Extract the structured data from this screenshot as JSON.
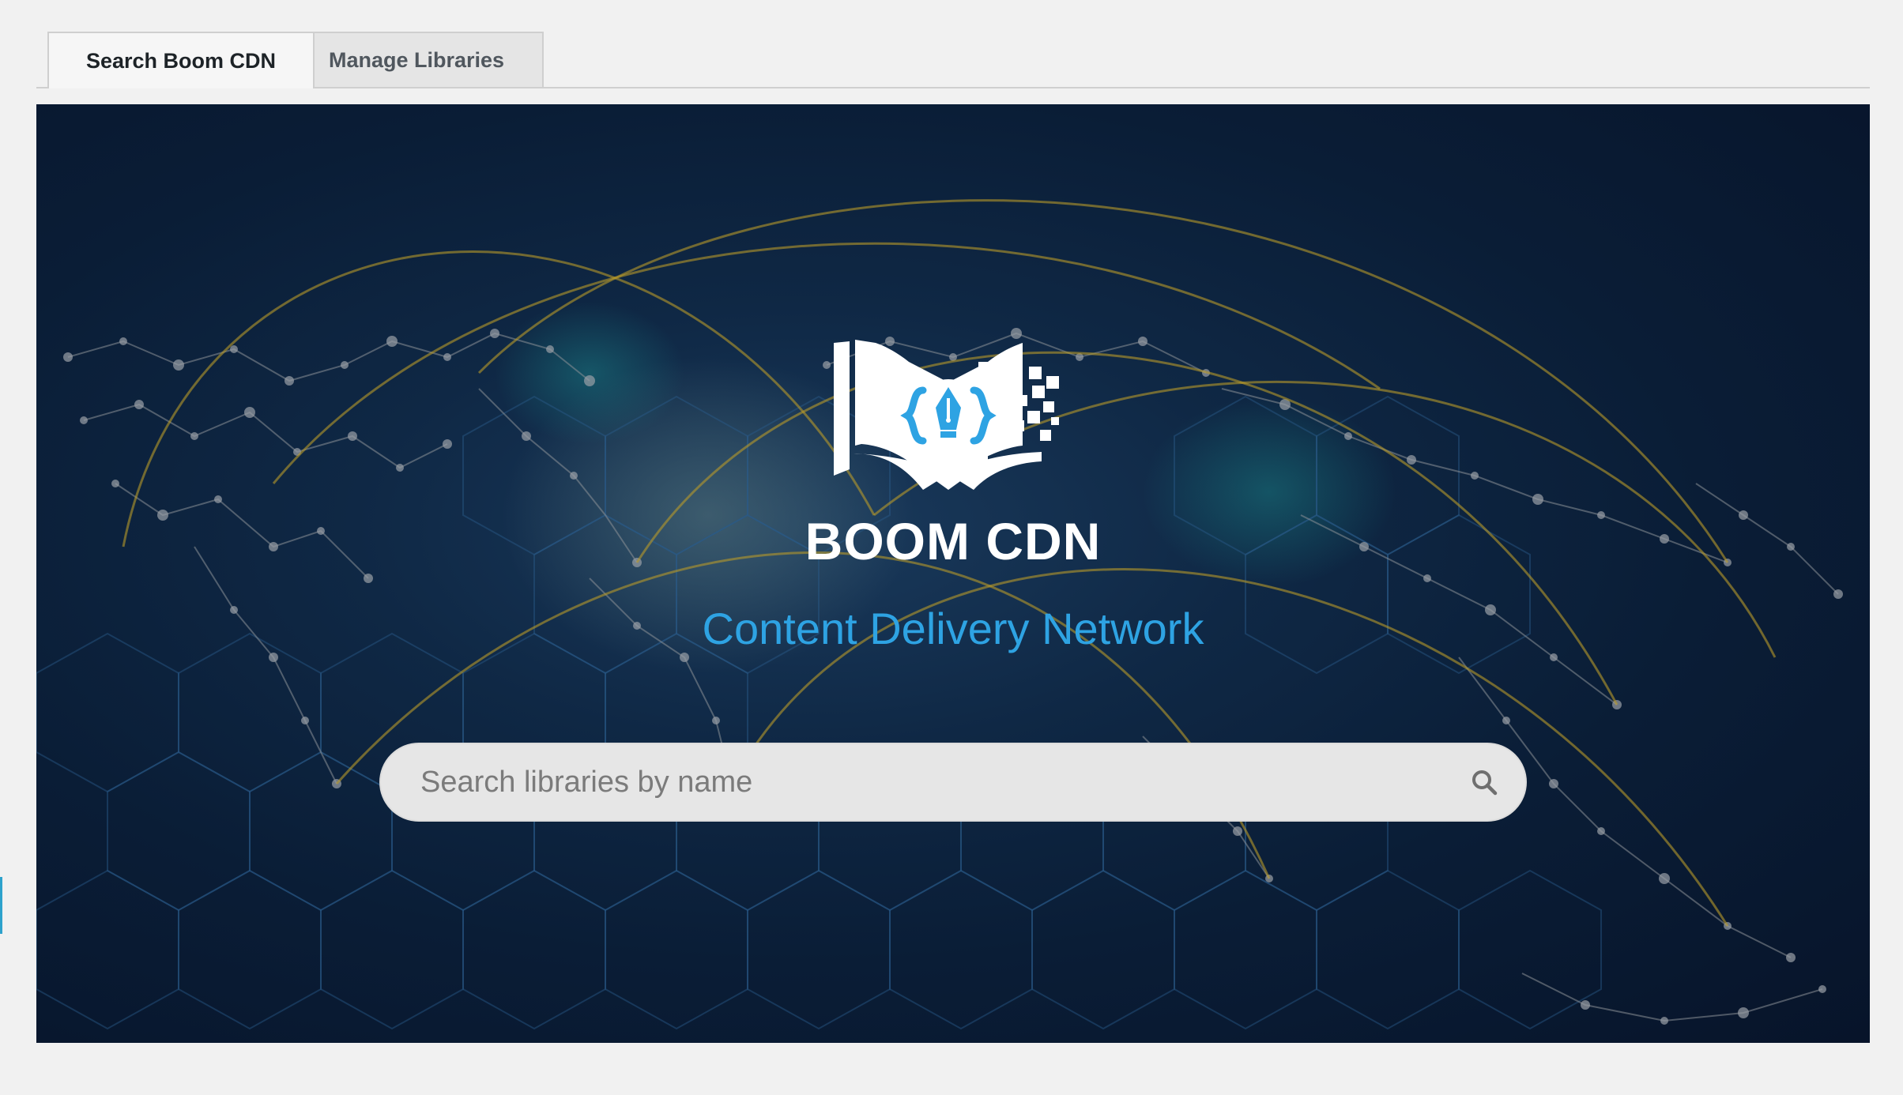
{
  "tabs": [
    {
      "label": "Search Boom CDN",
      "active": true
    },
    {
      "label": "Manage Libraries",
      "active": false
    }
  ],
  "hero": {
    "logo_icon": "book-code-pen-icon",
    "brand_name": "BOOM CDN",
    "tagline": "Content Delivery Network",
    "background": "world-network-map"
  },
  "search": {
    "placeholder": "Search libraries by name",
    "value": "",
    "icon": "search-icon"
  },
  "colors": {
    "accent": "#2ea3e3",
    "hero_dark": "#0a1d36",
    "page_bg": "#f1f1f1",
    "network_line": "#b89a2a"
  }
}
